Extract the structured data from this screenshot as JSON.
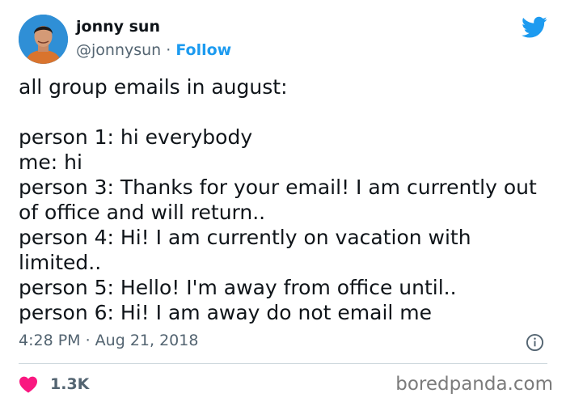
{
  "author": {
    "display_name": "jonny sun",
    "handle": "@jonnysun",
    "separator": " · ",
    "follow_label": "Follow"
  },
  "tweet": {
    "lines": [
      "all group emails in august:",
      "",
      "person 1: hi everybody",
      "me: hi",
      "person 3: Thanks for your email! I am currently out",
      "of office and will return..",
      "person 4: Hi! I am currently on vacation with",
      "limited..",
      "person 5: Hello! I'm away from office until..",
      "person 6: Hi! I am away do not email me"
    ],
    "timestamp": "4:28 PM · Aug 21, 2018"
  },
  "engagement": {
    "likes": "1.3K"
  },
  "watermark": "boredpanda.com",
  "colors": {
    "twitter_blue": "#1d9bf0",
    "heart_red": "#f91880",
    "secondary_text": "#536471"
  },
  "icons": {
    "platform": "twitter-bird-icon",
    "info": "info-icon",
    "like": "heart-icon"
  }
}
